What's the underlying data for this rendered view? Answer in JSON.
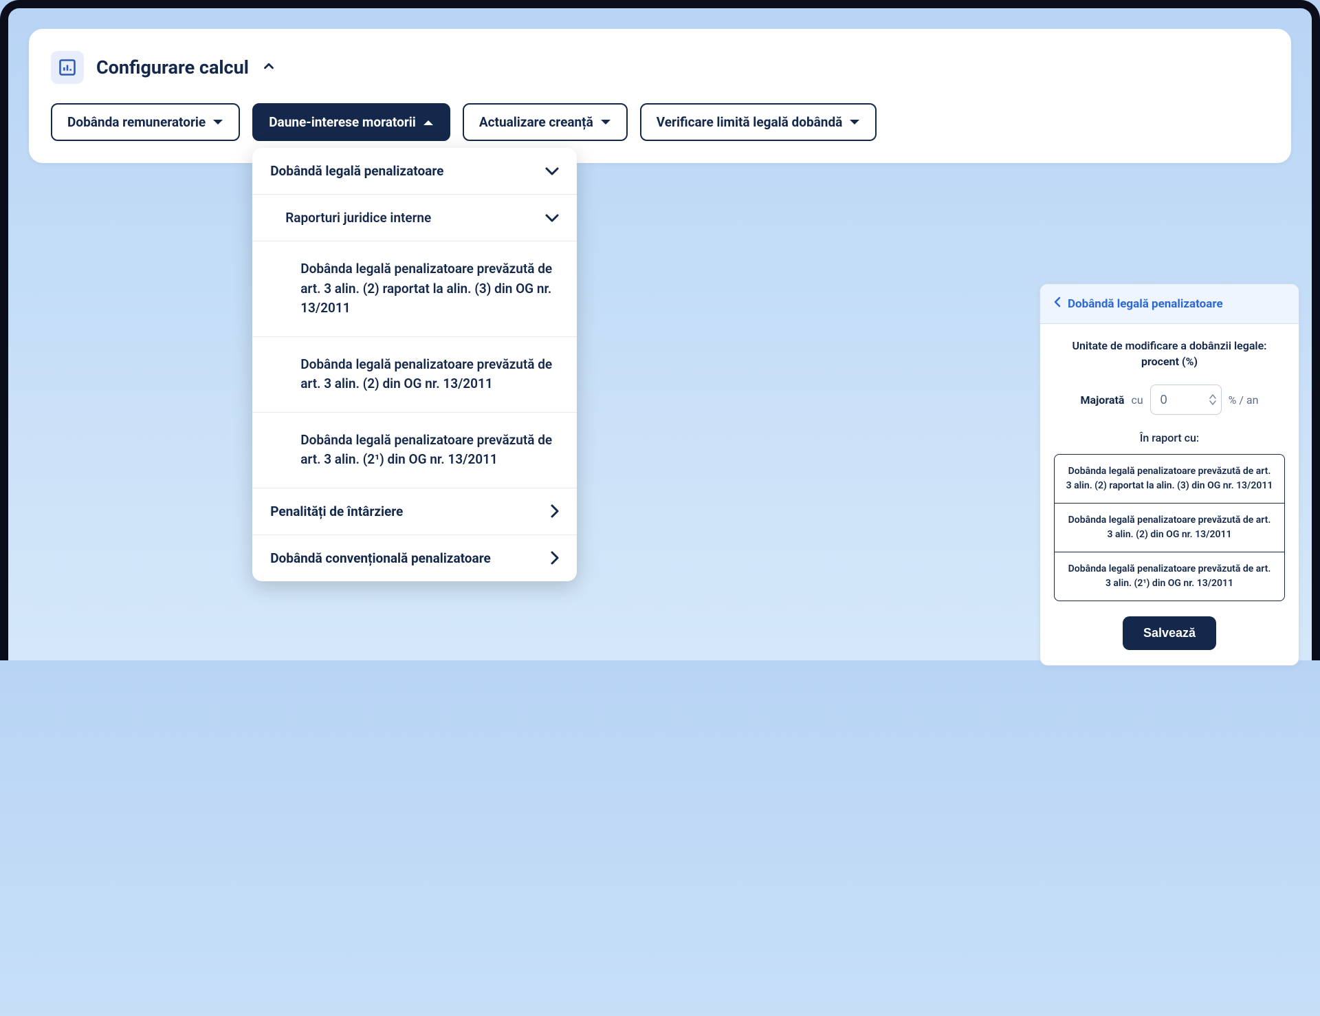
{
  "header": {
    "title": "Configurare calcul"
  },
  "chips": [
    {
      "label": "Dobânda remuneratorie",
      "active": false,
      "open": false
    },
    {
      "label": "Daune-interese moratorii",
      "active": true,
      "open": true
    },
    {
      "label": "Actualizare creanță",
      "active": false,
      "open": false
    },
    {
      "label": "Verificare limită legală dobândă",
      "active": false,
      "open": false
    }
  ],
  "dropdown": {
    "groups": [
      {
        "label": "Dobândă legală penalizatoare",
        "icon": "chevron-down"
      },
      {
        "label": "Raporturi juridice interne",
        "icon": "chevron-down",
        "indent": 1
      },
      {
        "label": "Dobânda legală penalizatoare prevăzută de art. 3 alin. (2) raportat la alin. (3) din OG nr. 13/2011",
        "indent": 2
      },
      {
        "label": "Dobânda legală penalizatoare prevăzută de art. 3 alin. (2) din OG nr. 13/2011",
        "indent": 2
      },
      {
        "label": "Dobânda legală penalizatoare prevăzută de art. 3 alin. (2¹) din OG nr. 13/2011",
        "indent": 2
      },
      {
        "label": "Penalități de întârziere",
        "icon": "chevron-right"
      },
      {
        "label": "Dobândă convențională penalizatoare",
        "icon": "chevron-right"
      }
    ]
  },
  "panel": {
    "back_label": "Dobândă legală penalizatoare",
    "unit_label": "Unitate de modificare a dobânzii legale:",
    "unit_value": "procent (%)",
    "majorata": "Majorată",
    "cu": "cu",
    "value": "0",
    "unit_suffix": "% / an",
    "raport_label": "În raport cu:",
    "options": [
      "Dobânda legală penalizatoare prevăzută de art. 3 alin. (2) raportat la alin. (3) din OG nr. 13/2011",
      "Dobânda legală penalizatoare prevăzută de art. 3 alin. (2) din OG nr. 13/2011",
      "Dobânda legală penalizatoare prevăzută de art. 3 alin. (2¹) din OG nr. 13/2011"
    ],
    "save_label": "Salvează"
  }
}
